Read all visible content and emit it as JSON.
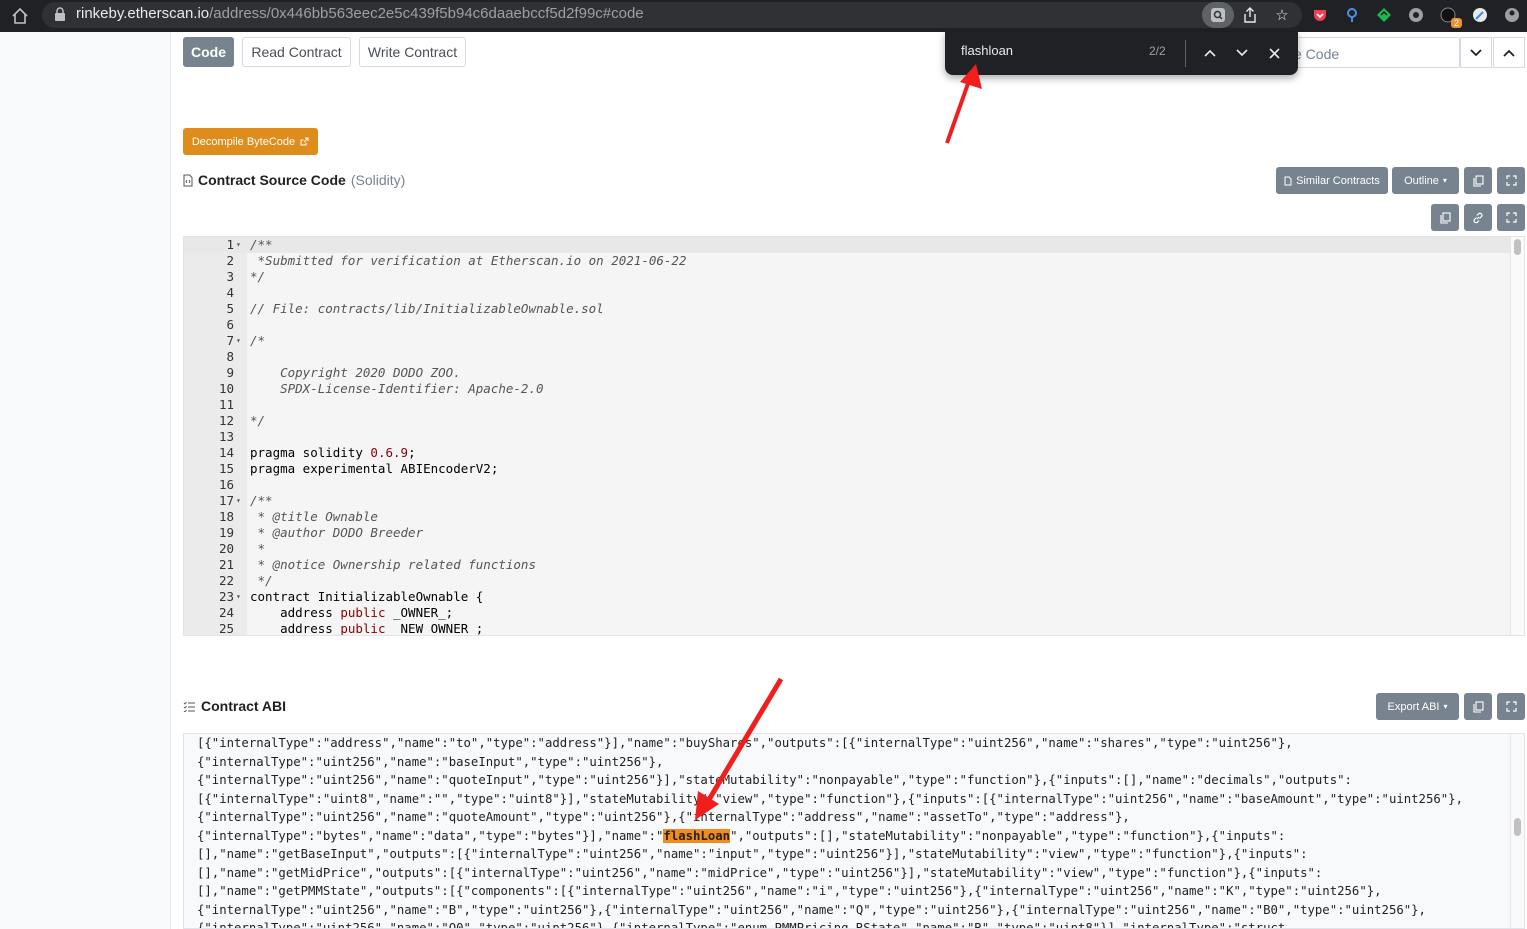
{
  "browser": {
    "url_host": "rinkeby.etherscan.io",
    "url_path": "/address/0x446bb563eec2e5c439f5b94c6daaebccf5d2f99c#code",
    "extension_badge": "2"
  },
  "find": {
    "query": "flashloan",
    "count": "2/2"
  },
  "tabs": {
    "code": "Code",
    "read": "Read Contract",
    "write": "Write Contract"
  },
  "toolbar": {
    "search_placeholder_partial": "e Code"
  },
  "decompile": {
    "label": "Decompile ByteCode"
  },
  "source": {
    "title": "Contract Source Code",
    "lang": "(Solidity)",
    "similar": "Similar Contracts",
    "outline": "Outline"
  },
  "code_lines": [
    {
      "n": "1",
      "fold": true,
      "t": "/**"
    },
    {
      "n": "2",
      "t": " *Submitted for verification at Etherscan.io on 2021-06-22"
    },
    {
      "n": "3",
      "t": "*/"
    },
    {
      "n": "4",
      "t": ""
    },
    {
      "n": "5",
      "t": "// File: contracts/lib/InitializableOwnable.sol"
    },
    {
      "n": "6",
      "t": ""
    },
    {
      "n": "7",
      "fold": true,
      "t": "/*"
    },
    {
      "n": "8",
      "t": ""
    },
    {
      "n": "9",
      "t": "    Copyright 2020 DODO ZOO."
    },
    {
      "n": "10",
      "t": "    SPDX-License-Identifier: Apache-2.0"
    },
    {
      "n": "11",
      "t": ""
    },
    {
      "n": "12",
      "t": "*/"
    },
    {
      "n": "13",
      "t": ""
    },
    {
      "n": "14",
      "t": "pragma solidity 0.6.9;"
    },
    {
      "n": "15",
      "t": "pragma experimental ABIEncoderV2;"
    },
    {
      "n": "16",
      "t": ""
    },
    {
      "n": "17",
      "fold": true,
      "t": "/**"
    },
    {
      "n": "18",
      "t": " * @title Ownable"
    },
    {
      "n": "19",
      "t": " * @author DODO Breeder"
    },
    {
      "n": "20",
      "t": " *"
    },
    {
      "n": "21",
      "t": " * @notice Ownership related functions"
    },
    {
      "n": "22",
      "t": " */"
    },
    {
      "n": "23",
      "fold": true,
      "t": "contract InitializableOwnable {"
    },
    {
      "n": "24",
      "t": "    address public _OWNER_;"
    },
    {
      "n": "25",
      "t": "    address public _NEW_OWNER_;"
    }
  ],
  "abi": {
    "title": "Contract ABI",
    "export": "Export ABI",
    "lines": [
      "[{\"internalType\":\"address\",\"name\":\"to\",\"type\":\"address\"}],\"name\":\"buyShares\",\"outputs\":[{\"internalType\":\"uint256\",\"name\":\"shares\",\"type\":\"uint256\"},",
      "{\"internalType\":\"uint256\",\"name\":\"baseInput\",\"type\":\"uint256\"},",
      "{\"internalType\":\"uint256\",\"name\":\"quoteInput\",\"type\":\"uint256\"}],\"stateMutability\":\"nonpayable\",\"type\":\"function\"},{\"inputs\":[],\"name\":\"decimals\",\"outputs\":",
      "[{\"internalType\":\"uint8\",\"name\":\"\",\"type\":\"uint8\"}],\"stateMutability\":\"view\",\"type\":\"function\"},{\"inputs\":[{\"internalType\":\"uint256\",\"name\":\"baseAmount\",\"type\":\"uint256\"},",
      "{\"internalType\":\"uint256\",\"name\":\"quoteAmount\",\"type\":\"uint256\"},{\"internalType\":\"address\",\"name\":\"assetTo\",\"type\":\"address\"},",
      "[],\"name\":\"getBaseInput\",\"outputs\":[{\"internalType\":\"uint256\",\"name\":\"input\",\"type\":\"uint256\"}],\"stateMutability\":\"view\",\"type\":\"function\"},{\"inputs\":",
      "[],\"name\":\"getMidPrice\",\"outputs\":[{\"internalType\":\"uint256\",\"name\":\"midPrice\",\"type\":\"uint256\"}],\"stateMutability\":\"view\",\"type\":\"function\"},{\"inputs\":",
      "[],\"name\":\"getPMMState\",\"outputs\":[{\"components\":[{\"internalType\":\"uint256\",\"name\":\"i\",\"type\":\"uint256\"},{\"internalType\":\"uint256\",\"name\":\"K\",\"type\":\"uint256\"},",
      "{\"internalType\":\"uint256\",\"name\":\"B\",\"type\":\"uint256\"},{\"internalType\":\"uint256\",\"name\":\"Q\",\"type\":\"uint256\"},{\"internalType\":\"uint256\",\"name\":\"B0\",\"type\":\"uint256\"},",
      "{\"internalType\":\"uint256\",\"name\":\"Q0\",\"type\":\"uint256\"},{\"internalType\":\"enum PMMPricing.RState\",\"name\":\"R\",\"type\":\"uint8\"}],\"internalType\":\"struct"
    ],
    "hl_before": "{\"internalType\":\"bytes\",\"name\":\"data\",\"type\":\"bytes\"}],\"name\":\"",
    "hl_match": "flashLoan",
    "hl_after": "\",\"outputs\":[],\"stateMutability\":\"nonpayable\",\"type\":\"function\"},{\"inputs\":"
  },
  "colors": {
    "accent_orange": "#de8c1c",
    "highlight": "#f28a1c",
    "annotation_red": "#f21d1d"
  }
}
